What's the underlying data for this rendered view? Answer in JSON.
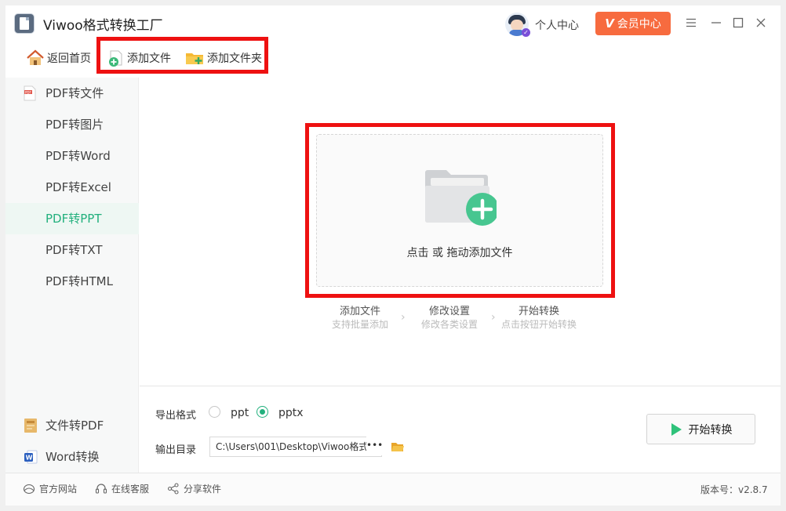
{
  "window": {
    "title": "Viwoo格式转换工厂",
    "personal_center": "个人中心",
    "vip_label": "会员中心",
    "vip_icon": "V"
  },
  "toolbar": {
    "home_label": "返回首页",
    "add_file_label": "添加文件",
    "add_folder_label": "添加文件夹"
  },
  "sidebar": {
    "section_pdf": "PDF转文件",
    "items": [
      {
        "label": "PDF转图片"
      },
      {
        "label": "PDF转Word"
      },
      {
        "label": "PDF转Excel"
      },
      {
        "label": "PDF转PPT",
        "active": true
      },
      {
        "label": "PDF转TXT"
      },
      {
        "label": "PDF转HTML"
      }
    ],
    "file_to_pdf": "文件转PDF",
    "word_convert": "Word转换"
  },
  "drop_zone": {
    "text": "点击 或 拖动添加文件"
  },
  "steps": [
    {
      "title": "添加文件",
      "subtitle": "支持批量添加"
    },
    {
      "title": "修改设置",
      "subtitle": "修改各类设置"
    },
    {
      "title": "开始转换",
      "subtitle": "点击按钮开始转换"
    }
  ],
  "settings": {
    "export_label": "导出格式",
    "formats": [
      {
        "label": "ppt",
        "selected": false
      },
      {
        "label": "pptx",
        "selected": true
      }
    ],
    "output_label": "输出目录",
    "output_path": "C:\\Users\\001\\Desktop\\Viwoo格式",
    "output_ellipsis": "•••",
    "start_label": "开始转换"
  },
  "footer": {
    "official_site": "官方网站",
    "online_service": "在线客服",
    "share_software": "分享软件",
    "version": "版本号：v2.8.7"
  },
  "colors": {
    "accent": "#22b07d",
    "vip": "#f76b3f",
    "highlight": "#ee1111"
  }
}
